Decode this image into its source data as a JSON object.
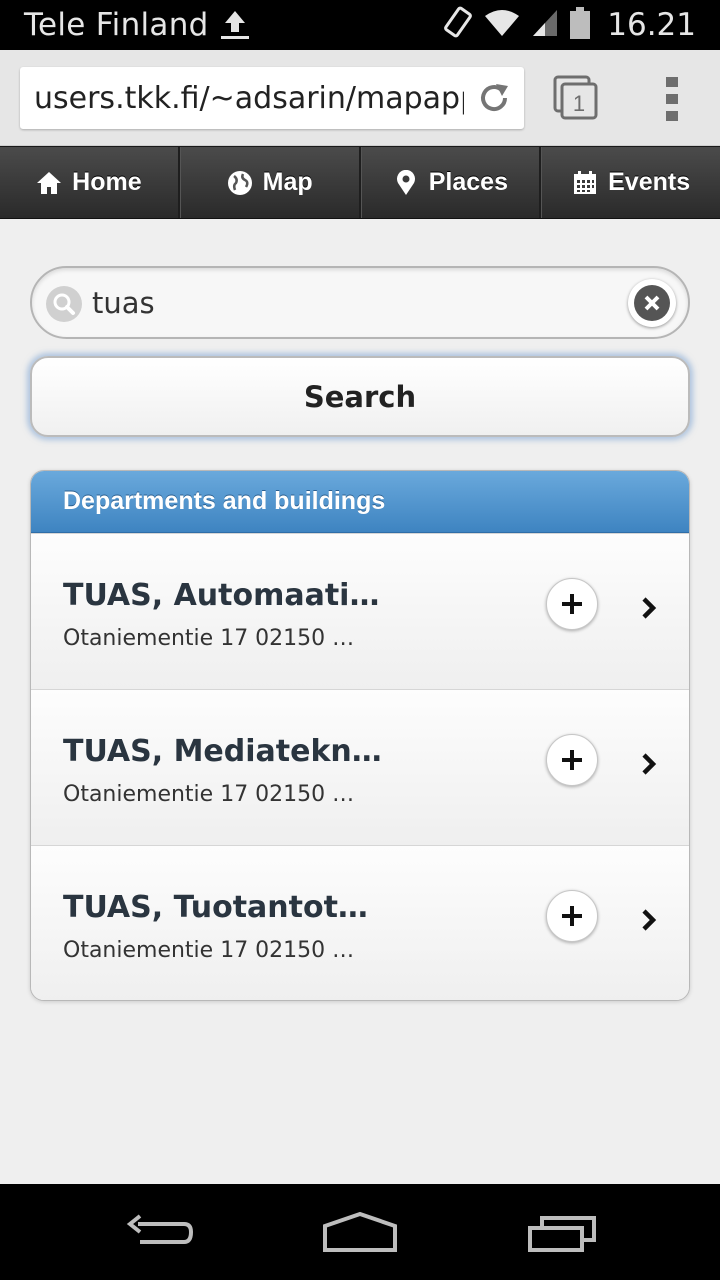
{
  "status_bar": {
    "carrier": "Tele Finland",
    "time": "16.21"
  },
  "browser": {
    "url": "users.tkk.fi/~adsarin/mapapp/",
    "tab_count": "1"
  },
  "navbar": {
    "items": [
      {
        "label": "Home",
        "icon": "home-icon"
      },
      {
        "label": "Map",
        "icon": "globe-icon"
      },
      {
        "label": "Places",
        "icon": "location-pin-icon"
      },
      {
        "label": "Events",
        "icon": "calendar-icon"
      }
    ]
  },
  "search": {
    "value": "tuas",
    "button_label": "Search"
  },
  "results": {
    "header": "Departments and buildings",
    "items": [
      {
        "title": "TUAS, Automaati…",
        "subtitle": "Otaniementie 17 02150 …"
      },
      {
        "title": "TUAS, Mediatekn…",
        "subtitle": "Otaniementie 17 02150 …"
      },
      {
        "title": "TUAS, Tuotantot…",
        "subtitle": "Otaniementie 17 02150 …"
      }
    ]
  }
}
